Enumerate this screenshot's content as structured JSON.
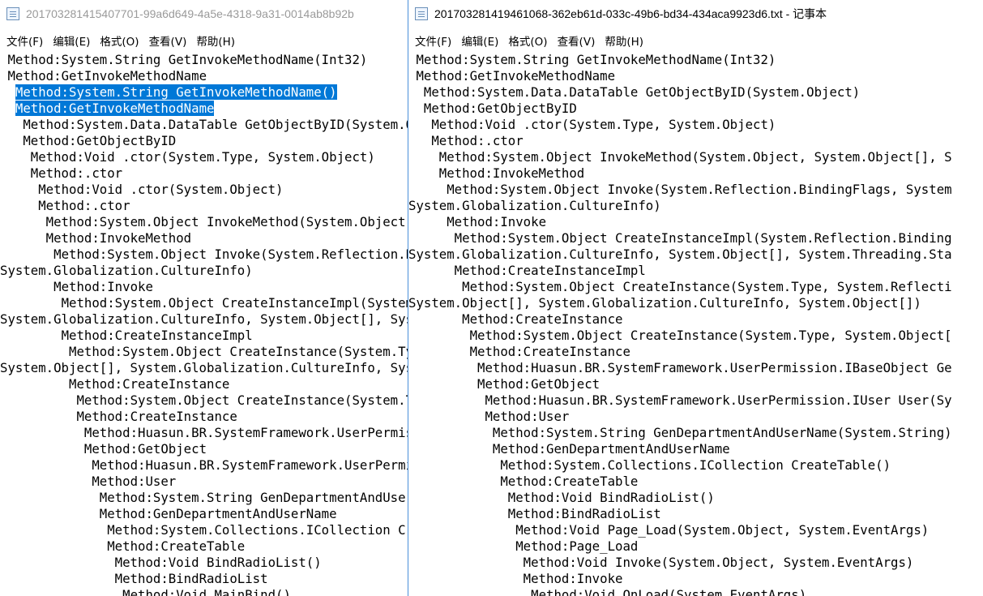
{
  "left_window": {
    "title": "201703281415407701-99a6d649-4a5e-4318-9a31-0014ab8b92b",
    "menu": [
      "文件(F)",
      "编辑(E)",
      "格式(O)",
      "查看(V)",
      "帮助(H)"
    ],
    "lines": [
      {
        "indent": 1,
        "text": "Method:System.String GetInvokeMethodName(Int32)"
      },
      {
        "indent": 1,
        "text": "Method:GetInvokeMethodName"
      },
      {
        "indent": 2,
        "text": "Method:System.String GetInvokeMethodName()",
        "selected": true
      },
      {
        "indent": 2,
        "text": "Method:GetInvokeMethodName",
        "selected": true
      },
      {
        "indent": 3,
        "text": "Method:System.Data.DataTable GetObjectByID(System.Object)"
      },
      {
        "indent": 3,
        "text": "Method:GetObjectByID"
      },
      {
        "indent": 4,
        "text": "Method:Void .ctor(System.Type, System.Object)"
      },
      {
        "indent": 4,
        "text": "Method:.ctor"
      },
      {
        "indent": 5,
        "text": "Method:Void .ctor(System.Object)"
      },
      {
        "indent": 5,
        "text": "Method:.ctor"
      },
      {
        "indent": 6,
        "text": "Method:System.Object InvokeMethod(System.Object, System.Object[], S"
      },
      {
        "indent": 6,
        "text": "Method:InvokeMethod"
      },
      {
        "indent": 7,
        "text": "Method:System.Object Invoke(System.Reflection.BindingFlags, System"
      },
      {
        "indent": 0,
        "text": "System.Globalization.CultureInfo)"
      },
      {
        "indent": 7,
        "text": "Method:Invoke"
      },
      {
        "indent": 8,
        "text": "Method:System.Object CreateInstanceImpl(System.Reflection.Binding"
      },
      {
        "indent": 0,
        "text": "System.Globalization.CultureInfo, System.Object[], System.Threading.Sta"
      },
      {
        "indent": 8,
        "text": "Method:CreateInstanceImpl"
      },
      {
        "indent": 9,
        "text": "Method:System.Object CreateInstance(System.Type, System.Reflecti"
      },
      {
        "indent": 0,
        "text": "System.Object[], System.Globalization.CultureInfo, System.Object[])"
      },
      {
        "indent": 9,
        "text": "Method:CreateInstance"
      },
      {
        "indent": 10,
        "text": "Method:System.Object CreateInstance(System.Type, System.Object["
      },
      {
        "indent": 10,
        "text": "Method:CreateInstance"
      },
      {
        "indent": 11,
        "text": "Method:Huasun.BR.SystemFramework.UserPermission.IBaseObject Ge"
      },
      {
        "indent": 11,
        "text": "Method:GetObject"
      },
      {
        "indent": 12,
        "text": "Method:Huasun.BR.SystemFramework.UserPermission.IUser User(Sy"
      },
      {
        "indent": 12,
        "text": "Method:User"
      },
      {
        "indent": 13,
        "text": "Method:System.String GenDepartmentAndUserName(System.String)"
      },
      {
        "indent": 13,
        "text": "Method:GenDepartmentAndUserName"
      },
      {
        "indent": 14,
        "text": "Method:System.Collections.ICollection CreateTable()"
      },
      {
        "indent": 14,
        "text": "Method:CreateTable"
      },
      {
        "indent": 15,
        "text": "Method:Void BindRadioList()"
      },
      {
        "indent": 15,
        "text": "Method:BindRadioList"
      },
      {
        "indent": 16,
        "text": "Method:Void MainBind()"
      }
    ]
  },
  "right_window": {
    "title": "201703281419461068-362eb61d-033c-49b6-bd34-434aca9923d6.txt - 记事本",
    "menu": [
      "文件(F)",
      "编辑(E)",
      "格式(O)",
      "查看(V)",
      "帮助(H)"
    ],
    "lines": [
      {
        "indent": 1,
        "text": "Method:System.String GetInvokeMethodName(Int32)"
      },
      {
        "indent": 1,
        "text": "Method:GetInvokeMethodName"
      },
      {
        "indent": 2,
        "text": "Method:System.Data.DataTable GetObjectByID(System.Object)"
      },
      {
        "indent": 2,
        "text": "Method:GetObjectByID"
      },
      {
        "indent": 3,
        "text": "Method:Void .ctor(System.Type, System.Object)"
      },
      {
        "indent": 3,
        "text": "Method:.ctor"
      },
      {
        "indent": 4,
        "text": "Method:System.Object InvokeMethod(System.Object, System.Object[], S"
      },
      {
        "indent": 4,
        "text": "Method:InvokeMethod"
      },
      {
        "indent": 5,
        "text": "Method:System.Object Invoke(System.Reflection.BindingFlags, System"
      },
      {
        "indent": 0,
        "text": "System.Globalization.CultureInfo)"
      },
      {
        "indent": 5,
        "text": "Method:Invoke"
      },
      {
        "indent": 6,
        "text": "Method:System.Object CreateInstanceImpl(System.Reflection.Binding"
      },
      {
        "indent": 0,
        "text": "System.Globalization.CultureInfo, System.Object[], System.Threading.Sta"
      },
      {
        "indent": 6,
        "text": "Method:CreateInstanceImpl"
      },
      {
        "indent": 7,
        "text": "Method:System.Object CreateInstance(System.Type, System.Reflecti"
      },
      {
        "indent": 0,
        "text": "System.Object[], System.Globalization.CultureInfo, System.Object[])"
      },
      {
        "indent": 7,
        "text": "Method:CreateInstance"
      },
      {
        "indent": 8,
        "text": "Method:System.Object CreateInstance(System.Type, System.Object["
      },
      {
        "indent": 8,
        "text": "Method:CreateInstance"
      },
      {
        "indent": 9,
        "text": "Method:Huasun.BR.SystemFramework.UserPermission.IBaseObject Ge"
      },
      {
        "indent": 9,
        "text": "Method:GetObject"
      },
      {
        "indent": 10,
        "text": "Method:Huasun.BR.SystemFramework.UserPermission.IUser User(Sy"
      },
      {
        "indent": 10,
        "text": "Method:User"
      },
      {
        "indent": 11,
        "text": "Method:System.String GenDepartmentAndUserName(System.String)"
      },
      {
        "indent": 11,
        "text": "Method:GenDepartmentAndUserName"
      },
      {
        "indent": 12,
        "text": "Method:System.Collections.ICollection CreateTable()"
      },
      {
        "indent": 12,
        "text": "Method:CreateTable"
      },
      {
        "indent": 13,
        "text": "Method:Void BindRadioList()"
      },
      {
        "indent": 13,
        "text": "Method:BindRadioList"
      },
      {
        "indent": 14,
        "text": "Method:Void Page_Load(System.Object, System.EventArgs)"
      },
      {
        "indent": 14,
        "text": "Method:Page_Load"
      },
      {
        "indent": 15,
        "text": "Method:Void Invoke(System.Object, System.EventArgs)"
      },
      {
        "indent": 15,
        "text": "Method:Invoke"
      },
      {
        "indent": 16,
        "text": "Method:Void OnLoad(System.EventArgs)"
      }
    ]
  },
  "colors": {
    "selection_bg": "#0078d7",
    "selection_fg": "#ffffff",
    "active_border": "#4a90d9",
    "inactive_title": "#9a9a9a"
  }
}
